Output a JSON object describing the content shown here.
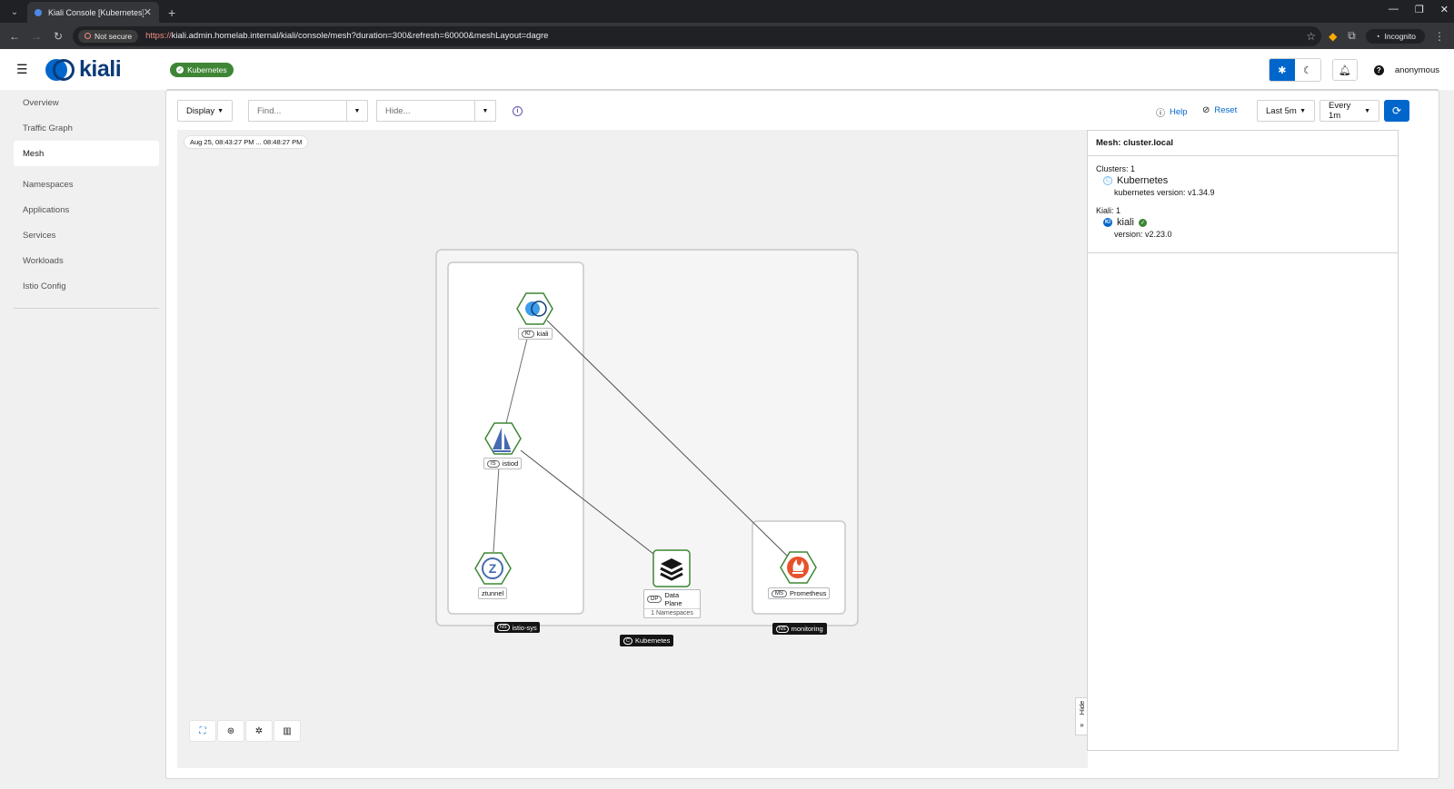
{
  "browser": {
    "tab_title": "Kiali Console [Kubernetes]",
    "not_secure": "Not secure",
    "url_scheme": "https://",
    "url_rest": "kiali.admin.homelab.internal/kiali/console/mesh?duration=300&refresh=60000&meshLayout=dagre",
    "incognito": "Incognito"
  },
  "masthead": {
    "logo_text": "kiali",
    "cluster_badge": "Kubernetes",
    "user": "anonymous"
  },
  "sidebar": {
    "items": [
      {
        "label": "Overview"
      },
      {
        "label": "Traffic Graph"
      },
      {
        "label": "Mesh"
      },
      {
        "label": "Namespaces"
      },
      {
        "label": "Applications"
      },
      {
        "label": "Services"
      },
      {
        "label": "Workloads"
      },
      {
        "label": "Istio Config"
      }
    ],
    "active": "Mesh"
  },
  "toolbar": {
    "display": "Display",
    "find_placeholder": "Find...",
    "hide_placeholder": "Hide...",
    "help": "Help",
    "reset": "Reset",
    "duration": "Last 5m",
    "refresh": "Every 1m"
  },
  "graph": {
    "timestamp": "Aug 25, 08:43:27 PM ... 08:48:27 PM",
    "nodes": {
      "kiali": {
        "badge": "KI",
        "label": "kiali"
      },
      "istiod": {
        "badge": "IS",
        "label": "istiod"
      },
      "ztunnel": {
        "label": "ztunnel"
      },
      "dataplane": {
        "badge": "DP",
        "label": "Data Plane",
        "sub": "1 Namespaces"
      },
      "prometheus": {
        "badge": "MS",
        "label": "Prometheus"
      }
    },
    "boxes": {
      "istio_system": {
        "badge": "NS",
        "label": "istio-sys"
      },
      "monitoring": {
        "badge": "NS",
        "label": "monitoring"
      },
      "cluster": {
        "badge": "C",
        "label": "Kubernetes"
      }
    },
    "hide_tab": "Hide"
  },
  "side_panel": {
    "title": "Mesh: cluster.local",
    "clusters_heading": "Clusters: 1",
    "cluster_name": "Kubernetes",
    "cluster_version": "kubernetes version: v1.34.9",
    "kiali_heading": "Kiali: 1",
    "kiali_name": "kiali",
    "kiali_version": "version: v2.23.0"
  },
  "colors": {
    "accent": "#0066cc",
    "success": "#3e8635",
    "node_border": "#3e8635",
    "prometheus": "#e6522c"
  }
}
